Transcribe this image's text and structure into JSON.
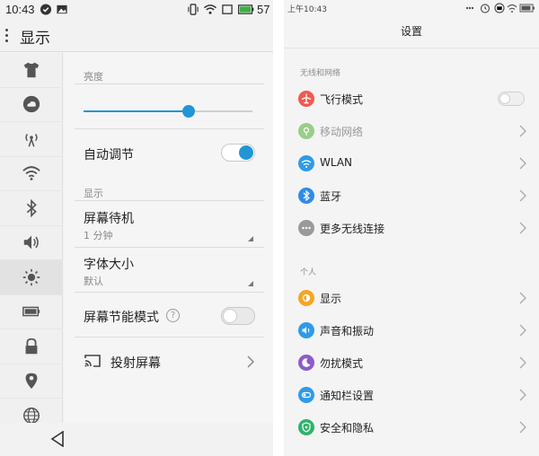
{
  "left_phone": {
    "status_bar": {
      "time": "10:43",
      "battery": "57"
    },
    "header": {
      "title": "显示"
    },
    "sidebar": [
      {
        "icon": "tshirt-icon"
      },
      {
        "icon": "cloud-icon"
      },
      {
        "icon": "signal-tower-icon"
      },
      {
        "icon": "wifi-icon"
      },
      {
        "icon": "bluetooth-icon"
      },
      {
        "icon": "volume-icon"
      },
      {
        "icon": "brightness-icon",
        "active": true
      },
      {
        "icon": "battery-icon"
      },
      {
        "icon": "lock-icon"
      },
      {
        "icon": "location-icon"
      },
      {
        "icon": "globe-icon"
      }
    ],
    "brightness": {
      "label": "亮度",
      "level": 0.62
    },
    "auto_adjust": {
      "label": "自动调节",
      "on": true
    },
    "display_section": {
      "label": "显示"
    },
    "screen_timeout": {
      "title": "屏幕待机",
      "value": "1 分钟"
    },
    "font_size": {
      "title": "字体大小",
      "value": "默认"
    },
    "power_saving": {
      "label": "屏幕节能模式",
      "help": "?",
      "on": false
    },
    "cast_screen": {
      "label": "投射屏幕"
    }
  },
  "right_phone": {
    "status_bar": {
      "time": "上午10:43"
    },
    "header": {
      "title": "设置"
    },
    "groups": [
      {
        "label": "无线和网络"
      },
      {
        "label": "个人"
      }
    ],
    "items": [
      {
        "label": "飞行模式",
        "icon": "airplane-icon",
        "color": "#f15a4f",
        "toggle": true
      },
      {
        "label": "移动网络",
        "icon": "mobile-network-icon",
        "color": "#9acd8a",
        "dim": true
      },
      {
        "label": "WLAN",
        "icon": "wifi-icon",
        "color": "#2f9be8"
      },
      {
        "label": "蓝牙",
        "icon": "bluetooth-icon",
        "color": "#2f8be8"
      },
      {
        "label": "更多无线连接",
        "icon": "more-icon",
        "color": "#9a9a9a"
      },
      {
        "label": "显示",
        "icon": "display-icon",
        "color": "#f5a623"
      },
      {
        "label": "声音和振动",
        "icon": "sound-icon",
        "color": "#2f9be8"
      },
      {
        "label": "勿扰模式",
        "icon": "moon-icon",
        "color": "#8e5cc9"
      },
      {
        "label": "通知栏设置",
        "icon": "notification-icon",
        "color": "#2f9be8"
      },
      {
        "label": "安全和隐私",
        "icon": "shield-icon",
        "color": "#2fb36b"
      }
    ]
  }
}
